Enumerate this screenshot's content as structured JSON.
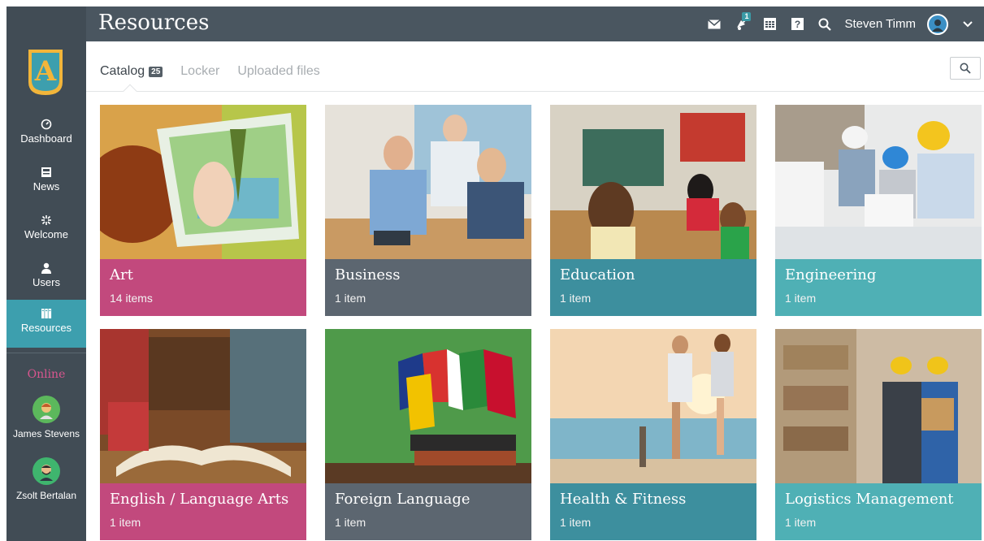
{
  "header": {
    "title": "Resources",
    "notification_count": "1",
    "user_name": "Steven Timm",
    "icons": [
      "mail-icon",
      "notification-icon",
      "calendar-icon",
      "help-icon",
      "search-icon",
      "chevron-down-icon"
    ]
  },
  "sidebar": {
    "items": [
      {
        "label": "Dashboard",
        "icon": "dashboard-icon"
      },
      {
        "label": "News",
        "icon": "news-icon"
      },
      {
        "label": "Welcome",
        "icon": "welcome-icon"
      },
      {
        "label": "Users",
        "icon": "user-icon"
      },
      {
        "label": "Resources",
        "icon": "resources-icon",
        "active": true
      }
    ],
    "online_label": "Online",
    "online_users": [
      {
        "name": "James Stevens"
      },
      {
        "name": "Zsolt Bertalan"
      }
    ]
  },
  "tabs": [
    {
      "label": "Catalog",
      "count": "25",
      "active": true
    },
    {
      "label": "Locker"
    },
    {
      "label": "Uploaded files"
    }
  ],
  "cards": [
    {
      "title": "Art",
      "count": "14 items",
      "color": "#c2497d"
    },
    {
      "title": "Business",
      "count": "1 item",
      "color": "#5c6670"
    },
    {
      "title": "Education",
      "count": "1 item",
      "color": "#3d8f9e"
    },
    {
      "title": "Engineering",
      "count": "1 item",
      "color": "#4fb0b5"
    },
    {
      "title": "English / Language Arts",
      "count": "1 item",
      "color": "#c2497d"
    },
    {
      "title": "Foreign Language",
      "count": "1 item",
      "color": "#5c6670"
    },
    {
      "title": "Health & Fitness",
      "count": "1 item",
      "color": "#3d8f9e"
    },
    {
      "title": "Logistics Management",
      "count": "1 item",
      "color": "#4fb0b5"
    }
  ]
}
